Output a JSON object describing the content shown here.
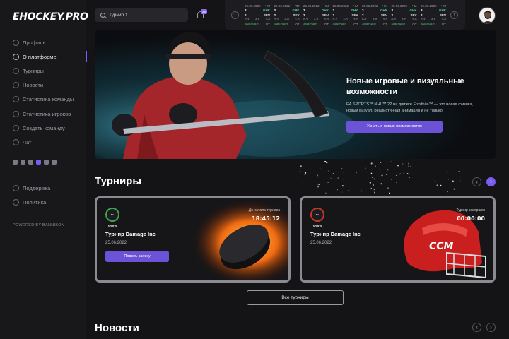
{
  "brand": "EHOCKEY.PRO",
  "sidebar": {
    "items": [
      {
        "label": "Профиль",
        "icon": "user-icon"
      },
      {
        "label": "О платформе",
        "icon": "trophy-icon"
      },
      {
        "label": "Турниры",
        "icon": "tournament-icon"
      },
      {
        "label": "Новости",
        "icon": "news-icon"
      },
      {
        "label": "Статистика команды",
        "icon": "team-stats-icon"
      },
      {
        "label": "Статистика игроков",
        "icon": "player-stats-icon"
      },
      {
        "label": "Создать команду",
        "icon": "create-team-icon"
      },
      {
        "label": "Чат",
        "icon": "chat-icon"
      }
    ],
    "active_index": 1,
    "socials": [
      "whatsapp-icon",
      "telegram-icon",
      "vk-icon",
      "youtube-icon",
      "twitch-icon",
      "discord-icon"
    ],
    "bottom_items": [
      {
        "label": "Поддержка",
        "icon": "support-icon"
      },
      {
        "label": "Политика",
        "icon": "shield-icon"
      }
    ],
    "powered": "POWERED BY BANNIKON"
  },
  "search": {
    "value": "Турнир 1"
  },
  "notifications": {
    "badge": "28"
  },
  "ticker": {
    "matches": [
      {
        "date": "25.06.2022",
        "badge": "ЧМ",
        "home": "GHK",
        "away": "SEV",
        "score_home": "3",
        "score_away": "2",
        "periods": [
          "0-2",
          "4-0",
          "2-0"
        ],
        "status": "ЗАВЕРШЕН",
        "ot": "ОТ"
      },
      {
        "date": "25.06.2022",
        "badge": "ЧМ",
        "home": "GHK",
        "away": "SEV",
        "score_home": "3",
        "score_away": "2",
        "periods": [
          "0-2",
          "4-0",
          "2-0"
        ],
        "status": "ЗАВЕРШЕН",
        "ot": "ОТ"
      },
      {
        "date": "25.06.2022",
        "badge": "ЧМ",
        "home": "GHK",
        "away": "SEV",
        "score_home": "3",
        "score_away": "2",
        "periods": [
          "0-2",
          "4-0",
          "2-0"
        ],
        "status": "ЗАВЕРШЕН",
        "ot": "ОТ"
      },
      {
        "date": "25.06.2022",
        "badge": "ЧМ",
        "home": "GHK",
        "away": "SEV",
        "score_home": "3",
        "score_away": "2",
        "periods": [
          "0-2",
          "4-0",
          "2-0"
        ],
        "status": "ЗАВЕРШЕН",
        "ot": "ОТ"
      },
      {
        "date": "25.06.2022",
        "badge": "ЧМ",
        "home": "GHK",
        "away": "SEV",
        "score_home": "3",
        "score_away": "2",
        "periods": [
          "0-2",
          "4-0",
          "2-0"
        ],
        "status": "ЗАВЕРШЕН",
        "ot": "ОТ"
      },
      {
        "date": "25.06.2022",
        "badge": "ЧМ",
        "home": "GHK",
        "away": "SEV",
        "score_home": "3",
        "score_away": "2",
        "periods": [
          "0-2",
          "4-0",
          "2-0"
        ],
        "status": "ЗАВЕРШЕН",
        "ot": "ОТ"
      },
      {
        "date": "25.06.2022",
        "badge": "ЧМ",
        "home": "GHK",
        "away": "SEV",
        "score_home": "3",
        "score_away": "2",
        "periods": [
          "0-2",
          "4-0",
          "2-0"
        ],
        "status": "ЗАВЕРШЕН",
        "ot": "ОТ"
      }
    ]
  },
  "hero": {
    "title": "Новые игровые и визуальные возможности",
    "description": "EA SPORTS™ NHL™ 22 на движке Frostbite™ — это новая физика, новый визуал, реалистичная анимация и не только.",
    "button": "Узнать о новых возможностях"
  },
  "tournaments": {
    "title": "Турниры",
    "cards": [
      {
        "logo": "EA SPORTS",
        "name": "Турнир Damage Inc",
        "date": "25.06.2022",
        "label": "До начала турнира",
        "time": "18:45:12",
        "button": "Подать заявку"
      },
      {
        "logo": "EA SPORTS",
        "name": "Турнир Damage Inc",
        "date": "25.06.2022",
        "label": "Турнир завершен",
        "time": "00:00:00"
      }
    ],
    "all_button": "Все турниры"
  },
  "news": {
    "title": "Новости"
  },
  "colors": {
    "accent": "#7a5cf0",
    "button": "#6b52d6",
    "background": "#141416",
    "live_green": "#4cd37c"
  }
}
